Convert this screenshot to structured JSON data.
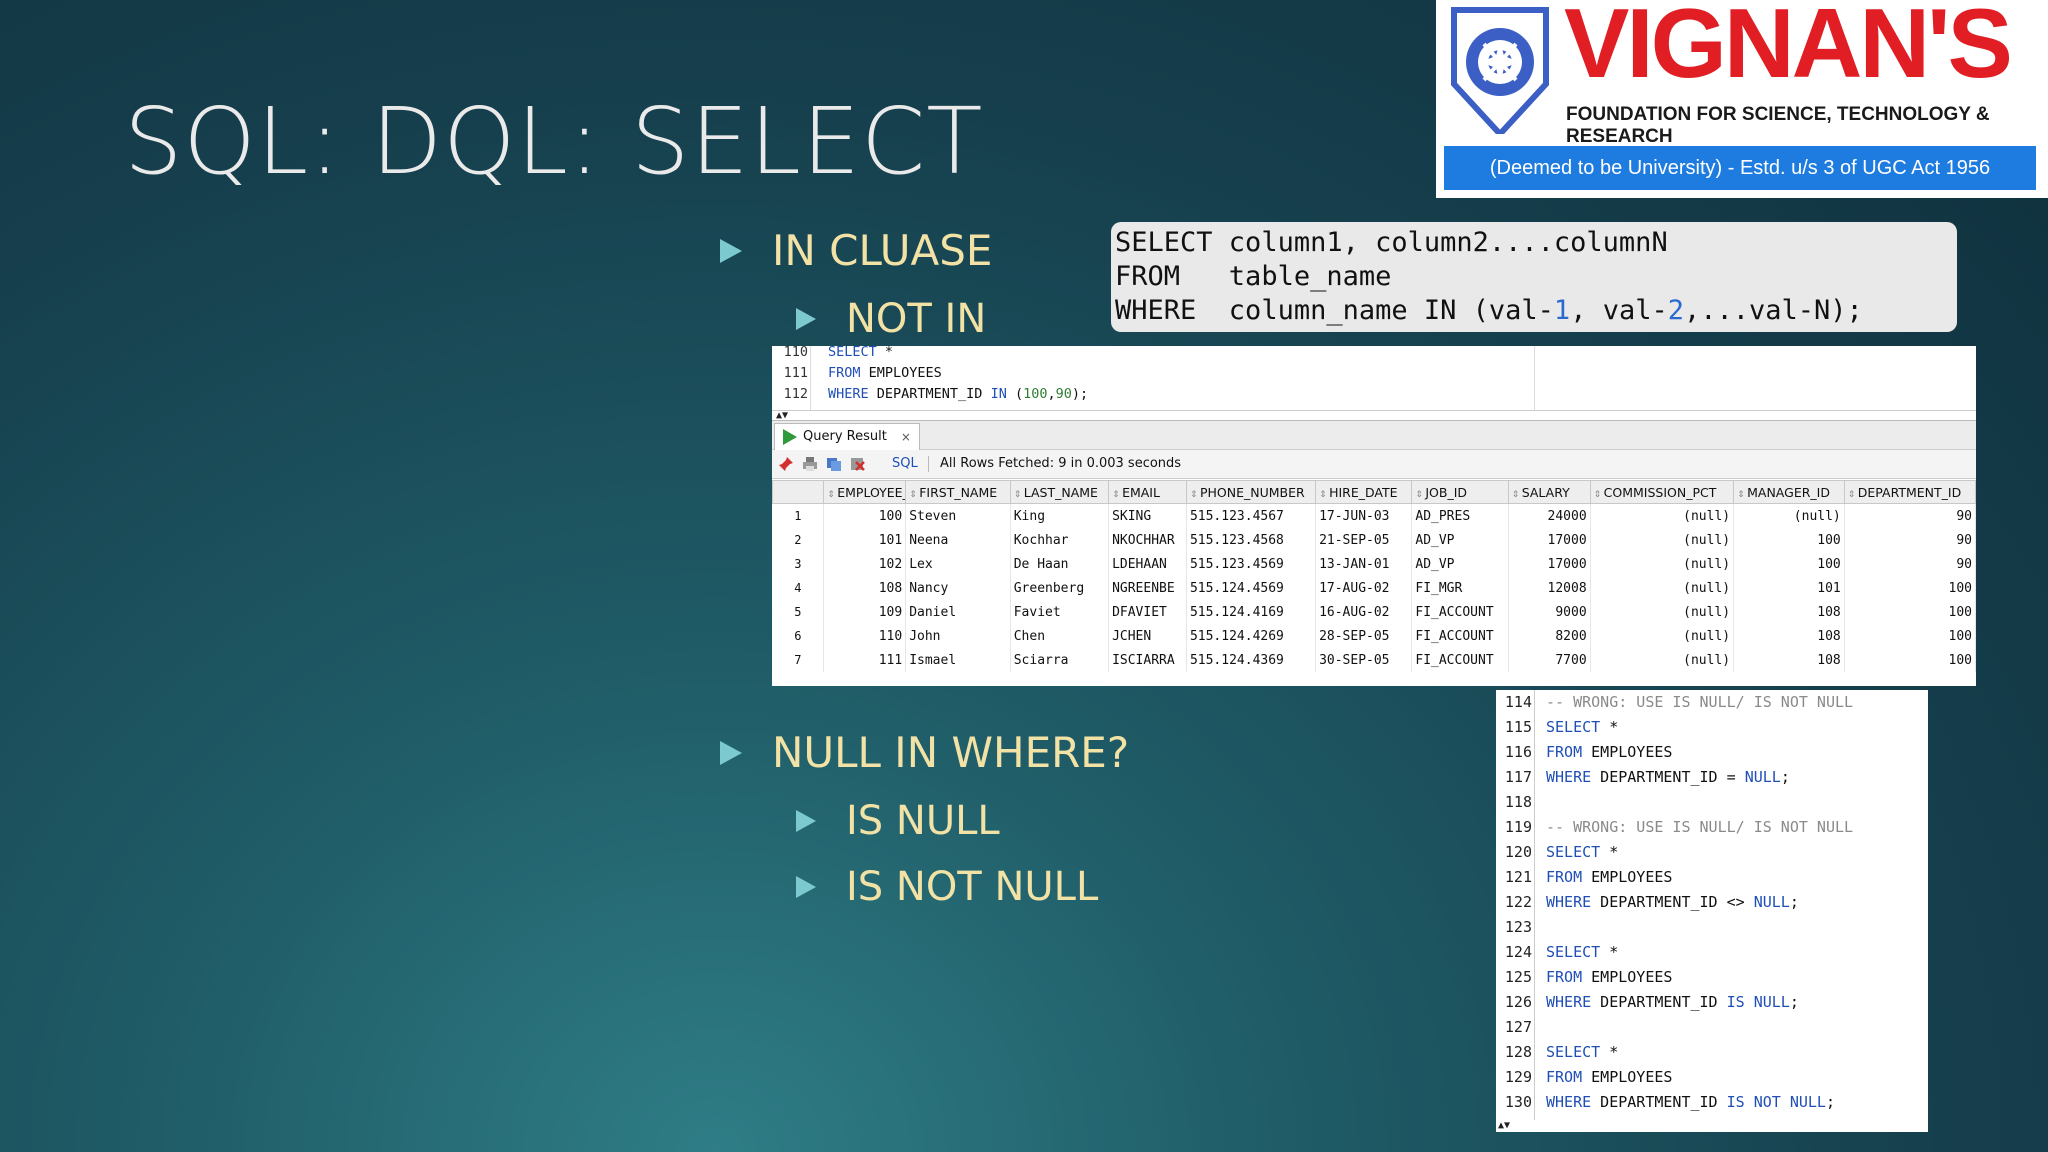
{
  "slide": {
    "title": "SQL: DQL: SELECT",
    "bullets": {
      "in_clause": "IN CLUASE",
      "not_in": "NOT IN",
      "null_in_where": "NULL IN WHERE?",
      "is_null": "IS NULL",
      "is_not_null": "IS NOT NULL"
    }
  },
  "logo": {
    "name": "VIGNAN'S",
    "subtitle": "FOUNDATION FOR SCIENCE, TECHNOLOGY & RESEARCH",
    "bar": "(Deemed to be University) - Estd. u/s 3 of UGC Act 1956",
    "colors": {
      "red": "#e01e24",
      "blue": "#1e7be0"
    }
  },
  "syntax_box": {
    "line1_kw": "SELECT",
    "line1_rest": " column1, column2....columnN",
    "line2_kw": "FROM  ",
    "line2_rest": " table_name",
    "line3_kw": "WHERE ",
    "line3_a": " column_name IN (val-",
    "line3_n1": "1",
    "line3_b": ", val-",
    "line3_n2": "2",
    "line3_c": ",...val-N);"
  },
  "editor": {
    "lines": [
      {
        "num": "110",
        "kw": "SELECT",
        "rest": " *"
      },
      {
        "num": "111",
        "kw": "FROM",
        "rest": " EMPLOYEES"
      },
      {
        "num": "112",
        "kw": "WHERE",
        "rest": " DEPARTMENT_ID ",
        "kw2": "IN",
        "open": " (",
        "v1": "100",
        "comma": ",",
        "v2": "90",
        "close": ");"
      }
    ]
  },
  "result_panel": {
    "tab_label": "Query Result",
    "tab_close": "×",
    "sql_label": "SQL",
    "status": "All Rows Fetched: 9 in 0.003 seconds",
    "columns": [
      "EMPLOYEE_ID",
      "FIRST_NAME",
      "LAST_NAME",
      "EMAIL",
      "PHONE_NUMBER",
      "HIRE_DATE",
      "JOB_ID",
      "SALARY",
      "COMMISSION_PCT",
      "MANAGER_ID",
      "DEPARTMENT_ID"
    ],
    "rows": [
      [
        "1",
        "100",
        "Steven",
        "King",
        "SKING",
        "515.123.4567",
        "17-JUN-03",
        "AD_PRES",
        "24000",
        "(null)",
        "(null)",
        "90"
      ],
      [
        "2",
        "101",
        "Neena",
        "Kochhar",
        "NKOCHHAR",
        "515.123.4568",
        "21-SEP-05",
        "AD_VP",
        "17000",
        "(null)",
        "100",
        "90"
      ],
      [
        "3",
        "102",
        "Lex",
        "De Haan",
        "LDEHAAN",
        "515.123.4569",
        "13-JAN-01",
        "AD_VP",
        "17000",
        "(null)",
        "100",
        "90"
      ],
      [
        "4",
        "108",
        "Nancy",
        "Greenberg",
        "NGREENBE",
        "515.124.4569",
        "17-AUG-02",
        "FI_MGR",
        "12008",
        "(null)",
        "101",
        "100"
      ],
      [
        "5",
        "109",
        "Daniel",
        "Faviet",
        "DFAVIET",
        "515.124.4169",
        "16-AUG-02",
        "FI_ACCOUNT",
        "9000",
        "(null)",
        "108",
        "100"
      ],
      [
        "6",
        "110",
        "John",
        "Chen",
        "JCHEN",
        "515.124.4269",
        "28-SEP-05",
        "FI_ACCOUNT",
        "8200",
        "(null)",
        "108",
        "100"
      ],
      [
        "7",
        "111",
        "Ismael",
        "Sciarra",
        "ISCIARRA",
        "515.124.4369",
        "30-SEP-05",
        "FI_ACCOUNT",
        "7700",
        "(null)",
        "108",
        "100"
      ]
    ]
  },
  "code2": {
    "lines": [
      {
        "num": "114",
        "type": "comment",
        "text": "-- WRONG: USE IS NULL/ IS NOT NULL"
      },
      {
        "num": "115",
        "type": "sel",
        "kw": "SELECT",
        "rest": " *"
      },
      {
        "num": "116",
        "type": "sel",
        "kw": "FROM",
        "rest": " EMPLOYEES"
      },
      {
        "num": "117",
        "type": "where",
        "kw": "WHERE",
        "rest": " DEPARTMENT_ID = ",
        "kw2": "NULL",
        "tail": ";"
      },
      {
        "num": "118",
        "type": "blank"
      },
      {
        "num": "119",
        "type": "comment",
        "text": "-- WRONG: USE IS NULL/ IS NOT NULL"
      },
      {
        "num": "120",
        "type": "sel",
        "kw": "SELECT",
        "rest": " *"
      },
      {
        "num": "121",
        "type": "sel",
        "kw": "FROM",
        "rest": " EMPLOYEES"
      },
      {
        "num": "122",
        "type": "where",
        "kw": "WHERE",
        "rest": " DEPARTMENT_ID <> ",
        "kw2": "NULL",
        "tail": ";"
      },
      {
        "num": "123",
        "type": "blank"
      },
      {
        "num": "124",
        "type": "sel",
        "kw": "SELECT",
        "rest": " *"
      },
      {
        "num": "125",
        "type": "sel",
        "kw": "FROM",
        "rest": " EMPLOYEES"
      },
      {
        "num": "126",
        "type": "where",
        "kw": "WHERE",
        "rest": " DEPARTMENT_ID ",
        "kw2": "IS NULL",
        "tail": ";"
      },
      {
        "num": "127",
        "type": "blank"
      },
      {
        "num": "128",
        "type": "sel",
        "kw": "SELECT",
        "rest": " *"
      },
      {
        "num": "129",
        "type": "sel",
        "kw": "FROM",
        "rest": " EMPLOYEES"
      },
      {
        "num": "130",
        "type": "where",
        "kw": "WHERE",
        "rest": " DEPARTMENT_ID ",
        "kw2": "IS NOT NULL",
        "tail": ";"
      }
    ]
  }
}
